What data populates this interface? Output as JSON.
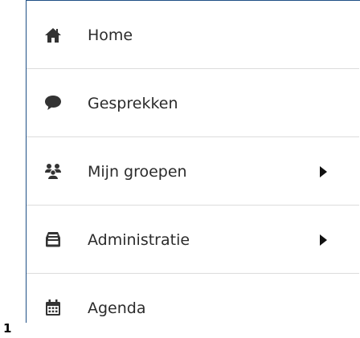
{
  "menu": {
    "items": [
      {
        "label": "Home",
        "icon": "home-icon",
        "has_submenu": false
      },
      {
        "label": "Gesprekken",
        "icon": "chat-bubble-icon",
        "has_submenu": false
      },
      {
        "label": "Mijn groepen",
        "icon": "users-icon",
        "has_submenu": true
      },
      {
        "label": "Administratie",
        "icon": "archive-icon",
        "has_submenu": true
      },
      {
        "label": "Agenda",
        "icon": "calendar-icon",
        "has_submenu": false
      }
    ]
  },
  "footer": {
    "page_number": "1"
  },
  "colors": {
    "icon": "#333333",
    "text": "#2b2b2b",
    "border": "#1f4f85",
    "divider": "#dcdcdc"
  }
}
